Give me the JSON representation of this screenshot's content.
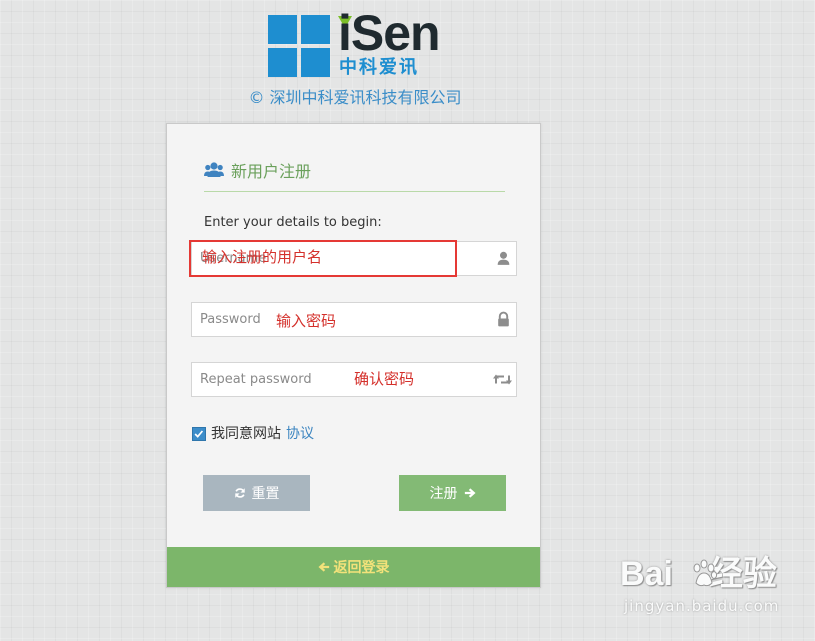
{
  "brand": {
    "wordmark": "iSen",
    "chinese_name": "中科爱讯",
    "copyright": "© 深圳中科爱讯科技有限公司",
    "colors": {
      "blue": "#1e8ed0",
      "green": "#7cbf2a",
      "dark": "#1f2a2f"
    }
  },
  "card": {
    "title": "新用户注册",
    "title_icon": "users-icon",
    "hint": "Enter your details to begin:"
  },
  "form": {
    "username": {
      "placeholder": "Username",
      "icon": "user-icon",
      "annotation": "输入注册的用户名"
    },
    "password": {
      "placeholder": "Password",
      "icon": "lock-icon",
      "annotation": "输入密码"
    },
    "repeat_password": {
      "placeholder": "Repeat password",
      "icon": "retweet-icon",
      "annotation": "确认密码"
    },
    "agreement": {
      "checked": true,
      "label": "我同意网站",
      "link": "协议"
    }
  },
  "buttons": {
    "reset": {
      "label": "重置",
      "icon": "refresh-icon"
    },
    "register": {
      "label": "注册",
      "icon": "arrow-right-icon"
    },
    "back_to_login": {
      "label": "返回登录",
      "icon": "arrow-left-icon"
    }
  },
  "watermark": {
    "text_a": "Bai",
    "text_b": "经验",
    "site": "jingyan.baidu.com"
  },
  "theme": {
    "accent_green": "#7cb66a",
    "annotation_red": "#d4302b",
    "link_blue": "#3c85c0"
  }
}
